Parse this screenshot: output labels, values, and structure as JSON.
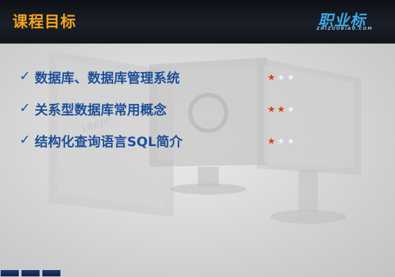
{
  "header": {
    "title": "课程目标",
    "logo_text": "职业标",
    "logo_sub": "ZHIZUOBIAO.COM"
  },
  "goals": [
    {
      "text": "数据库、数据库管理系统",
      "stars": 1,
      "max": 3
    },
    {
      "text": "关系型数据库常用概念",
      "stars": 2,
      "max": 3
    },
    {
      "text": "结构化查询语言SQL简介",
      "stars": 1,
      "max": 3
    }
  ],
  "icons": {
    "check": "checkmark-icon",
    "star": "star-icon"
  },
  "colors": {
    "title": "#f3a51a",
    "text": "#1d4f98",
    "star_on": "#d8401a",
    "star_off": "#f2f2f2",
    "logo": "#3ea8e8"
  }
}
